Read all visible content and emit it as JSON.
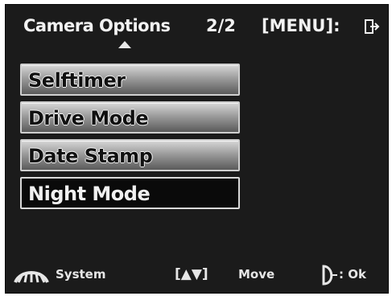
{
  "header": {
    "title": "Camera Options",
    "page": "2/2",
    "menu_hint": "[MENU]:"
  },
  "icons": {
    "exit": "exit-arrow-icon",
    "scroll_up": "up-arrow-icon",
    "system": "mode-dial-icon",
    "ok": "shutter-button-icon"
  },
  "menu": {
    "items": [
      {
        "label": "Selftimer"
      },
      {
        "label": "Drive Mode"
      },
      {
        "label": "Date Stamp"
      },
      {
        "label": "Night Mode",
        "selected": true
      }
    ]
  },
  "footer": {
    "system_label": "System",
    "move_keys": "[▲▼]",
    "move_label": "Move",
    "ok_label": ": Ok"
  },
  "colors": {
    "background": "#1b1b1b",
    "text": "#f2f2f2",
    "selected_item": "#0a0a0a"
  }
}
